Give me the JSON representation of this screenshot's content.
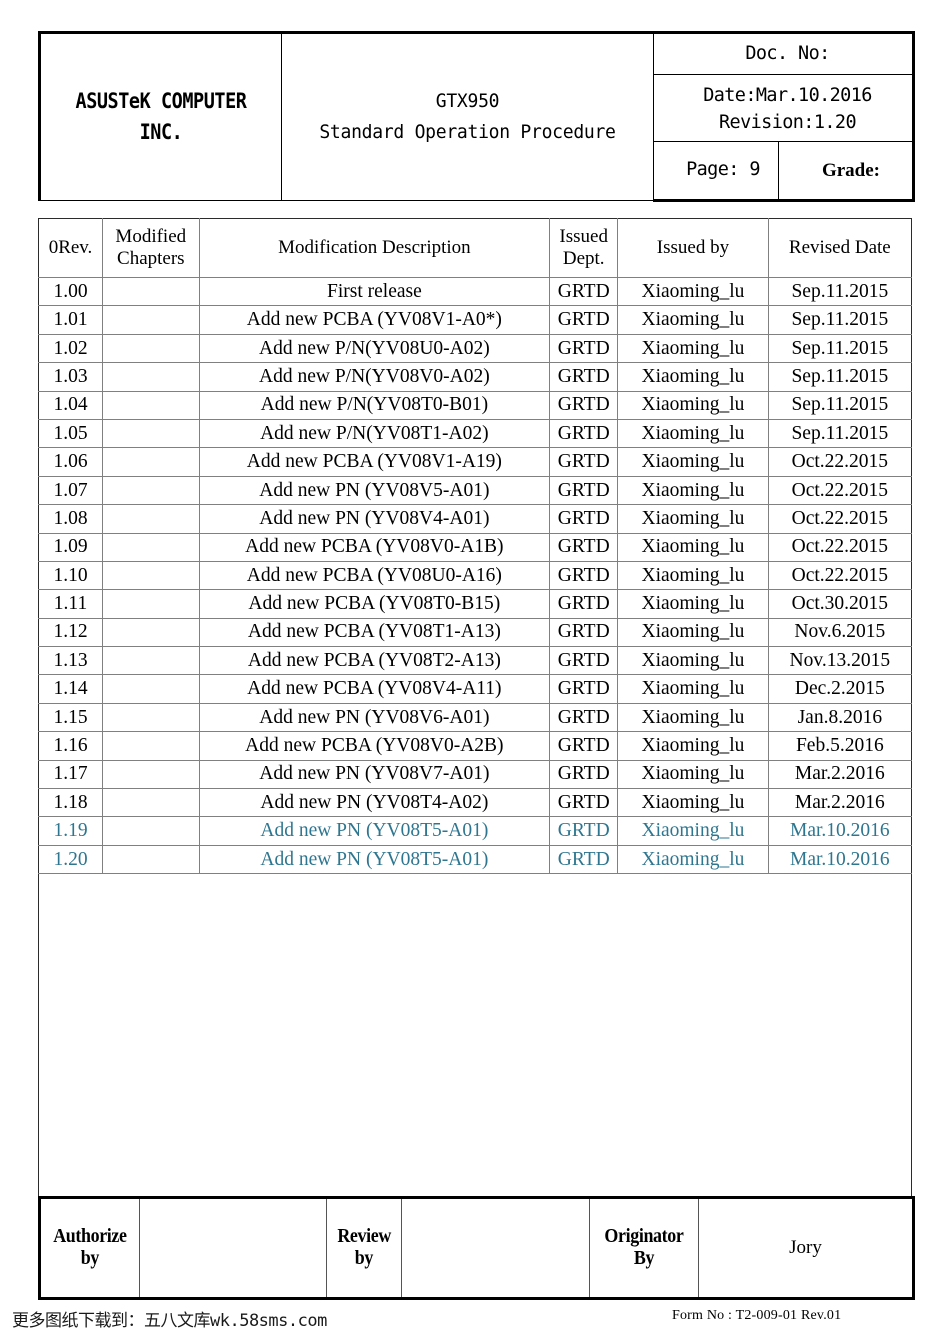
{
  "header": {
    "company": "ASUSTeK COMPUTER\nINC.",
    "company_line1": "ASUSTeK COMPUTER",
    "company_line2": "INC.",
    "doc_title_line1": "GTX950",
    "doc_title_line2": "Standard Operation Procedure",
    "doc_no_label": "Doc. No:",
    "date_line": "Date:Mar.10.2016",
    "revision_line": "Revision:1.20",
    "page_label": "Page: 9",
    "grade_label": "Grade:"
  },
  "revision_table": {
    "columns": [
      "0Rev.",
      "Modified\nChapters",
      "Modification Description",
      "Issued\nDept.",
      "Issued by",
      "Revised Date"
    ],
    "columns_split": [
      {
        "l1": "0Rev.",
        "l2": ""
      },
      {
        "l1": "Modified",
        "l2": "Chapters"
      },
      {
        "l1": "Modification Description",
        "l2": ""
      },
      {
        "l1": "Issued",
        "l2": "Dept."
      },
      {
        "l1": "Issued by",
        "l2": ""
      },
      {
        "l1": "Revised Date",
        "l2": ""
      }
    ],
    "highlight_color": "#2e768f",
    "rows": [
      {
        "rev": "1.00",
        "chapters": "",
        "description": "First release",
        "dept": "GRTD",
        "issued_by": "Xiaoming_lu",
        "date": "Sep.11.2015",
        "highlight": false
      },
      {
        "rev": "1.01",
        "chapters": "",
        "description": "Add new PCBA (YV08V1-A0*)",
        "dept": "GRTD",
        "issued_by": "Xiaoming_lu",
        "date": "Sep.11.2015",
        "highlight": false
      },
      {
        "rev": "1.02",
        "chapters": "",
        "description": "Add new P/N(YV08U0-A02)",
        "dept": "GRTD",
        "issued_by": "Xiaoming_lu",
        "date": "Sep.11.2015",
        "highlight": false
      },
      {
        "rev": "1.03",
        "chapters": "",
        "description": "Add new P/N(YV08V0-A02)",
        "dept": "GRTD",
        "issued_by": "Xiaoming_lu",
        "date": "Sep.11.2015",
        "highlight": false
      },
      {
        "rev": "1.04",
        "chapters": "",
        "description": "Add new P/N(YV08T0-B01)",
        "dept": "GRTD",
        "issued_by": "Xiaoming_lu",
        "date": "Sep.11.2015",
        "highlight": false
      },
      {
        "rev": "1.05",
        "chapters": "",
        "description": "Add new P/N(YV08T1-A02)",
        "dept": "GRTD",
        "issued_by": "Xiaoming_lu",
        "date": "Sep.11.2015",
        "highlight": false
      },
      {
        "rev": "1.06",
        "chapters": "",
        "description": "Add new PCBA (YV08V1-A19)",
        "dept": "GRTD",
        "issued_by": "Xiaoming_lu",
        "date": "Oct.22.2015",
        "highlight": false
      },
      {
        "rev": "1.07",
        "chapters": "",
        "description": "Add new PN (YV08V5-A01)",
        "dept": "GRTD",
        "issued_by": "Xiaoming_lu",
        "date": "Oct.22.2015",
        "highlight": false
      },
      {
        "rev": "1.08",
        "chapters": "",
        "description": "Add new PN (YV08V4-A01)",
        "dept": "GRTD",
        "issued_by": "Xiaoming_lu",
        "date": "Oct.22.2015",
        "highlight": false
      },
      {
        "rev": "1.09",
        "chapters": "",
        "description": "Add new PCBA (YV08V0-A1B)",
        "dept": "GRTD",
        "issued_by": "Xiaoming_lu",
        "date": "Oct.22.2015",
        "highlight": false
      },
      {
        "rev": "1.10",
        "chapters": "",
        "description": "Add new PCBA (YV08U0-A16)",
        "dept": "GRTD",
        "issued_by": "Xiaoming_lu",
        "date": "Oct.22.2015",
        "highlight": false
      },
      {
        "rev": "1.11",
        "chapters": "",
        "description": "Add new PCBA (YV08T0-B15)",
        "dept": "GRTD",
        "issued_by": "Xiaoming_lu",
        "date": "Oct.30.2015",
        "highlight": false
      },
      {
        "rev": "1.12",
        "chapters": "",
        "description": "Add new PCBA (YV08T1-A13)",
        "dept": "GRTD",
        "issued_by": "Xiaoming_lu",
        "date": "Nov.6.2015",
        "highlight": false
      },
      {
        "rev": "1.13",
        "chapters": "",
        "description": "Add new PCBA (YV08T2-A13)",
        "dept": "GRTD",
        "issued_by": "Xiaoming_lu",
        "date": "Nov.13.2015",
        "highlight": false
      },
      {
        "rev": "1.14",
        "chapters": "",
        "description": "Add new PCBA (YV08V4-A11)",
        "dept": "GRTD",
        "issued_by": "Xiaoming_lu",
        "date": "Dec.2.2015",
        "highlight": false
      },
      {
        "rev": "1.15",
        "chapters": "",
        "description": "Add new PN (YV08V6-A01)",
        "dept": "GRTD",
        "issued_by": "Xiaoming_lu",
        "date": "Jan.8.2016",
        "highlight": false
      },
      {
        "rev": "1.16",
        "chapters": "",
        "description": "Add new PCBA (YV08V0-A2B)",
        "dept": "GRTD",
        "issued_by": "Xiaoming_lu",
        "date": "Feb.5.2016",
        "highlight": false
      },
      {
        "rev": "1.17",
        "chapters": "",
        "description": "Add new PN (YV08V7-A01)",
        "dept": "GRTD",
        "issued_by": "Xiaoming_lu",
        "date": "Mar.2.2016",
        "highlight": false
      },
      {
        "rev": "1.18",
        "chapters": "",
        "description": "Add new PN (YV08T4-A02)",
        "dept": "GRTD",
        "issued_by": "Xiaoming_lu",
        "date": "Mar.2.2016",
        "highlight": false
      },
      {
        "rev": "1.19",
        "chapters": "",
        "description": "Add new PN (YV08T5-A01)",
        "dept": "GRTD",
        "issued_by": "Xiaoming_lu",
        "date": "Mar.10.2016",
        "highlight": true
      },
      {
        "rev": "1.20",
        "chapters": "",
        "description": "Add new PN (YV08T5-A01)",
        "dept": "GRTD",
        "issued_by": "Xiaoming_lu",
        "date": "Mar.10.2016",
        "highlight": true
      }
    ]
  },
  "signoff": {
    "authorize_label_l1": "Authorize",
    "authorize_label_l2": "by",
    "authorize_value": "",
    "review_label_l1": "Review",
    "review_label_l2": "by",
    "review_value": "",
    "originator_label_l1": "Originator",
    "originator_label_l2": "By",
    "originator_value": "Jory"
  },
  "footer": {
    "watermark": "更多图纸下载到：五八文库wk.58sms.com",
    "form_no": "Form  No : T2-009-01  Rev.01"
  }
}
